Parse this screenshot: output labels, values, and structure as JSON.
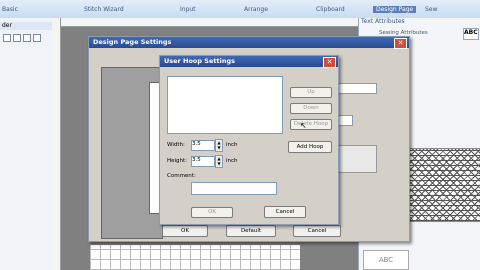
{
  "ribbon": {
    "items": [
      "Basic",
      "Stitch Wizard",
      "Input",
      "Arrange",
      "Clipboard",
      "Design Page",
      "Sew",
      "Text Attributes"
    ],
    "active": "Design Page",
    "text_attr_sub": "Sewing Attributes"
  },
  "left_panel": {
    "header": "der"
  },
  "right_panel": {
    "sample_text": "ABC"
  },
  "design_page_dialog": {
    "title": "Design Page Settings",
    "ok_label": "OK",
    "default_label": "Default",
    "cancel_label": "Cancel"
  },
  "user_hoop_dialog": {
    "title": "User Hoop Settings",
    "up_label": "Up",
    "down_label": "Down",
    "delete_label": "Delete Hoop",
    "add_label": "Add Hoop",
    "width_label": "Width:",
    "width_value": "3.5",
    "height_label": "Height:",
    "height_value": "3.5",
    "unit": "inch",
    "comment_label": "Comment:",
    "comment_value": "",
    "ok_label": "OK",
    "cancel_label": "Cancel"
  },
  "colors": {
    "title_blue": "#294b93",
    "accent": "#5b7fb8"
  }
}
